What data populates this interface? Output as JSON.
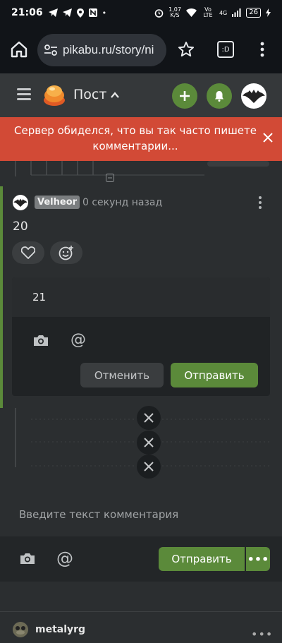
{
  "statusbar": {
    "time": "21:06",
    "net_speed_value": "1,07",
    "net_speed_unit": "K/S",
    "network": "4G",
    "lte": "Vo LTE",
    "battery": "26"
  },
  "browser": {
    "url": "pikabu.ru/story/ni",
    "ext_label": ":D"
  },
  "header": {
    "title": "Пост",
    "caret": "^"
  },
  "toast": {
    "message": "Сервер обиделся, что вы так часто пишете комментарии...",
    "close": "✕"
  },
  "comment": {
    "author": "Velheor",
    "time": "0 секунд назад",
    "body": "20"
  },
  "reply": {
    "value": "21",
    "at": "@",
    "cancel_label": "Отменить",
    "send_label": "Отправить"
  },
  "new_comment": {
    "placeholder": "Введите текст комментария",
    "at": "@",
    "send_label": "Отправить",
    "more": "•••"
  },
  "next_comment": {
    "author": "metalyrg",
    "more": "•••"
  },
  "colors": {
    "accent_green": "#5b8a3a",
    "toast_red": "#d24a36"
  }
}
